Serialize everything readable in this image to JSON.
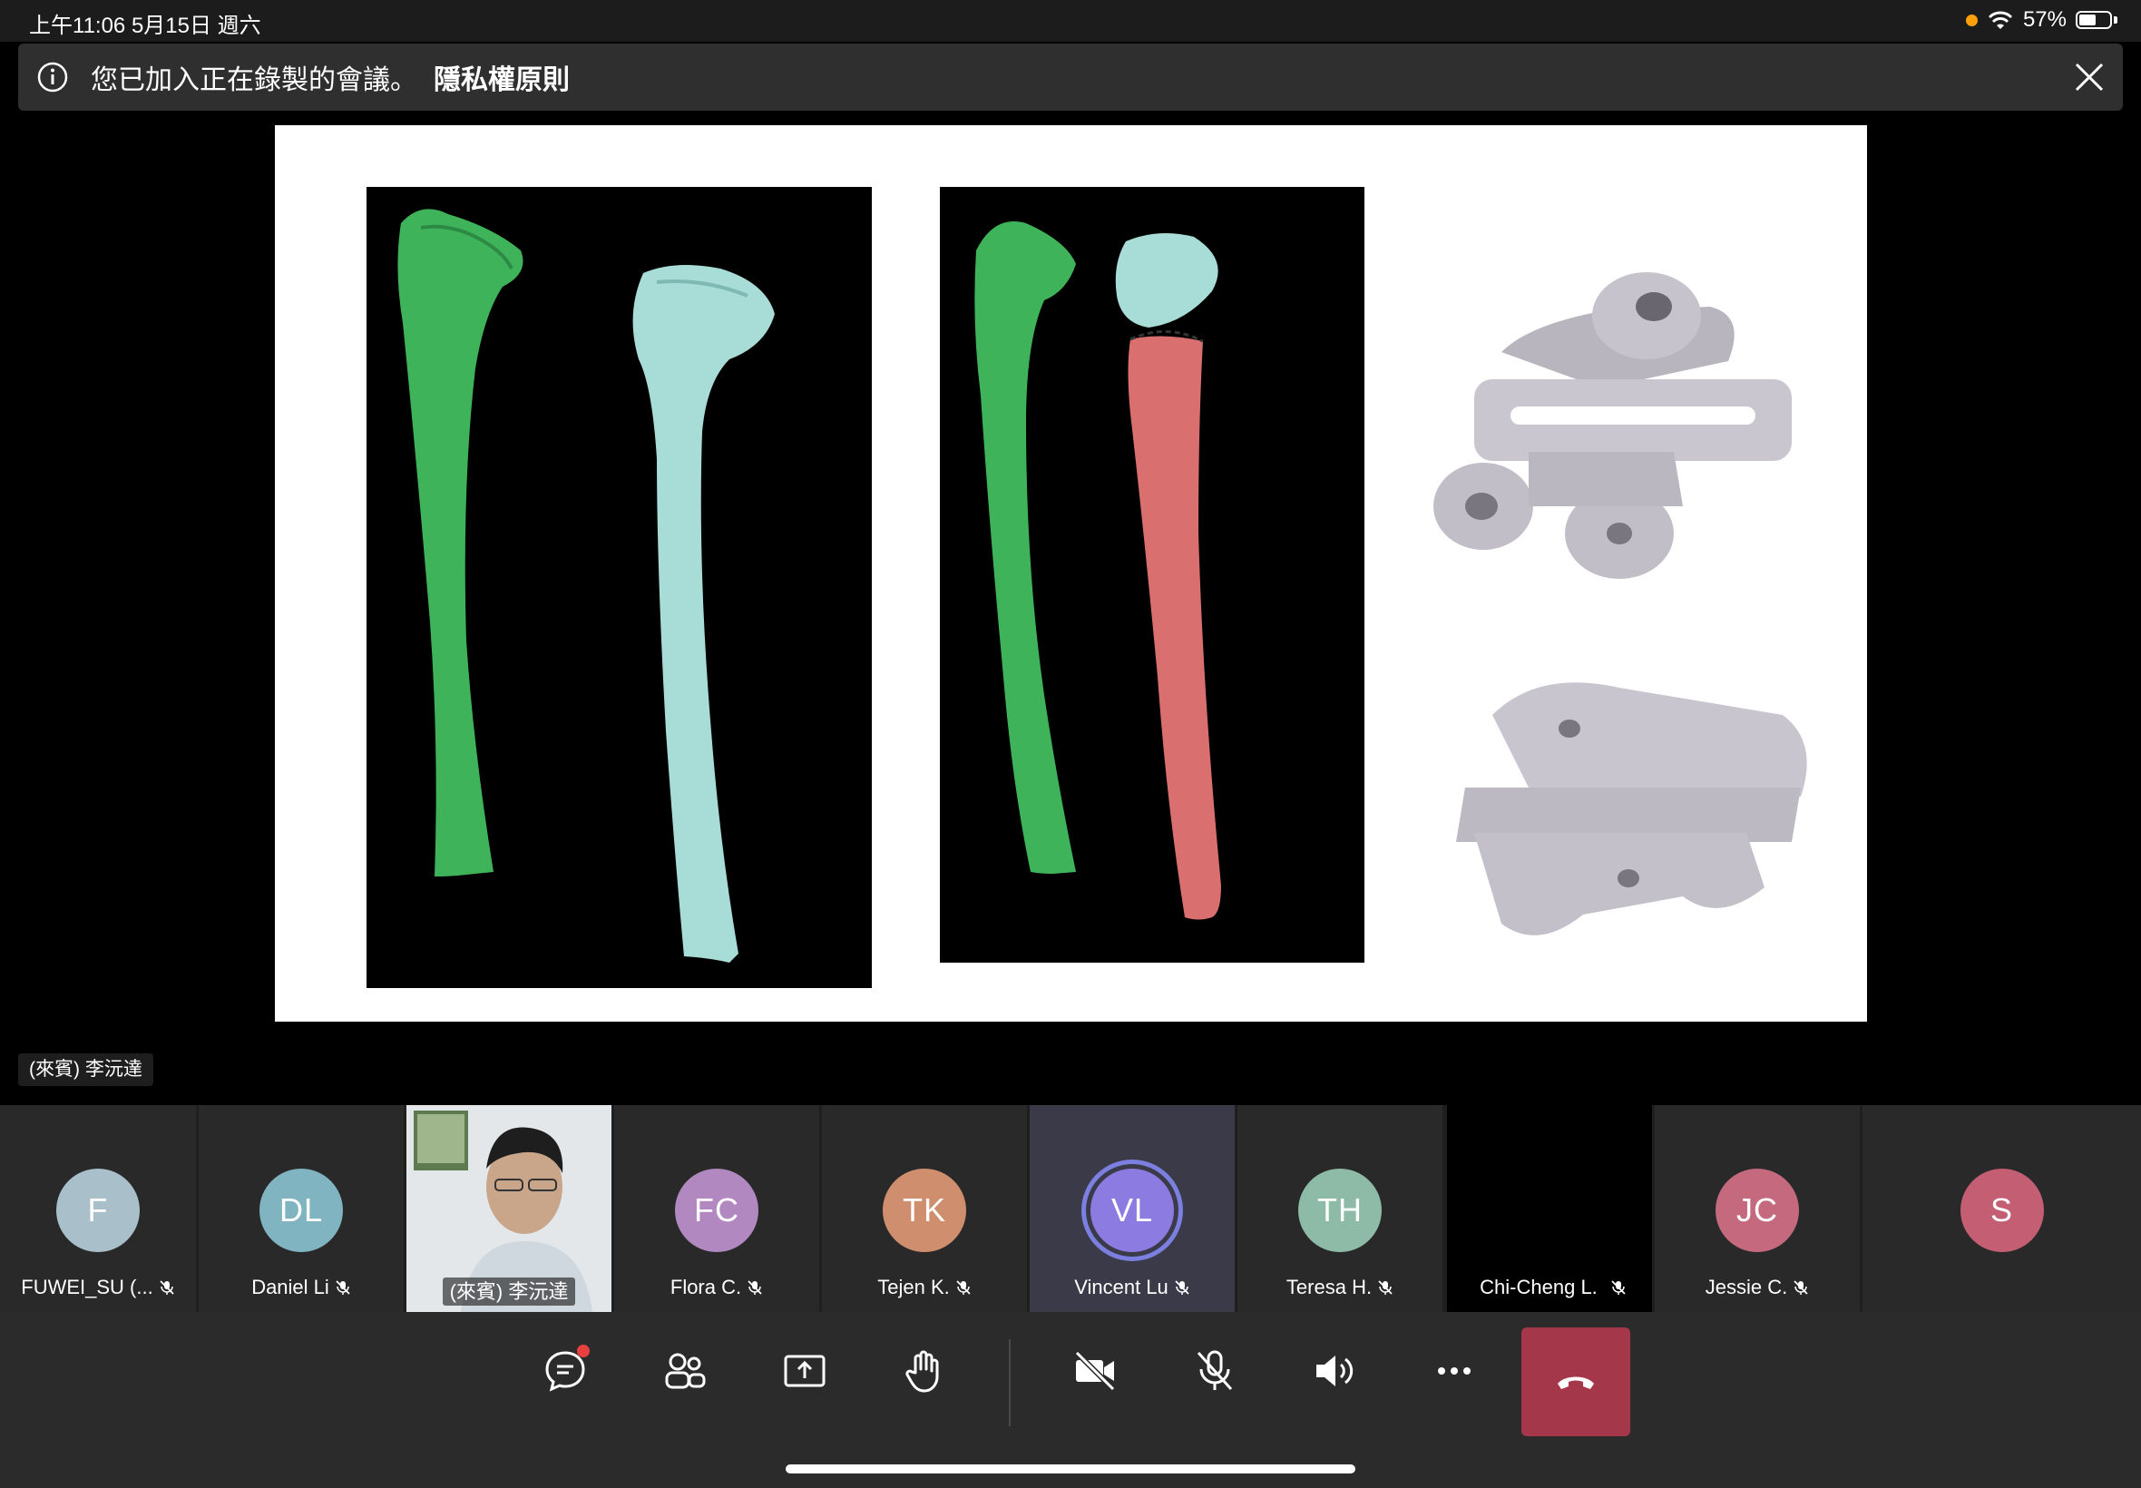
{
  "status_bar": {
    "time_date": "上午11:06   5月15日 週六",
    "battery": "57%",
    "battery_level": 0.57
  },
  "banner": {
    "message": "您已加入正在錄製的會議。",
    "link": "隱私權原則"
  },
  "speaker": {
    "label": "(來賓) 李沅達"
  },
  "participants": [
    {
      "initials": "F",
      "name": "FUWEI_SU (...",
      "color": "#a9c0ca"
    },
    {
      "initials": "DL",
      "name": "Daniel Li",
      "color": "#7fb4c0"
    },
    {
      "initials": "",
      "name": "(來賓) 李沅達",
      "color": "#dfe3e6"
    },
    {
      "initials": "FC",
      "name": "Flora C.",
      "color": "#b288c0"
    },
    {
      "initials": "TK",
      "name": "Tejen K.",
      "color": "#cf8e6d"
    },
    {
      "initials": "VL",
      "name": "Vincent Lu",
      "color": "#8c7be0"
    },
    {
      "initials": "TH",
      "name": "Teresa H.",
      "color": "#8ebba7"
    },
    {
      "initials": "",
      "name": "Chi-Cheng L.",
      "color": "#000000"
    },
    {
      "initials": "JC",
      "name": "Jessie C.",
      "color": "#c56a7e"
    },
    {
      "initials": "S",
      "name": "",
      "color": "#c45e73"
    }
  ],
  "toolbar": {
    "buttons": [
      "chat-icon",
      "people-icon",
      "share-icon",
      "raise-hand-icon",
      "camera-off-icon",
      "mic-off-icon",
      "speaker-icon",
      "more-icon",
      "hangup-icon"
    ]
  },
  "colors": {
    "accent": "#6264a7",
    "hangup": "#a4374a",
    "bone_green": "#3fb35a",
    "bone_cyan": "#a8dcd6",
    "bone_red": "#d9706f"
  }
}
